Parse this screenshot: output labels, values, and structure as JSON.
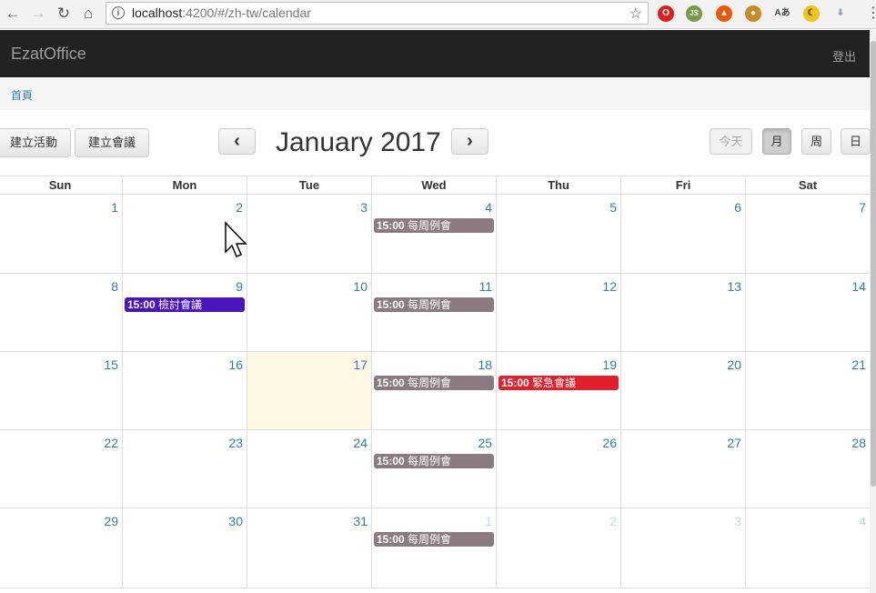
{
  "browser": {
    "url_host": "localhost",
    "url_rest": ":4200/#/zh-tw/calendar"
  },
  "navbar": {
    "brand": "EzatOffice",
    "logout": "登出"
  },
  "breadcrumb": {
    "home": "首頁"
  },
  "toolbar": {
    "create_activity": "建立活動",
    "create_meeting": "建立會議",
    "prev": "‹",
    "next": "›",
    "title": "January 2017",
    "today": "今天",
    "month": "月",
    "week": "周",
    "day": "日"
  },
  "weekdays": [
    "Sun",
    "Mon",
    "Tue",
    "Wed",
    "Thu",
    "Fri",
    "Sat"
  ],
  "weeks": [
    [
      {
        "d": "1"
      },
      {
        "d": "2"
      },
      {
        "d": "3"
      },
      {
        "d": "4",
        "e": {
          "time": "15:00",
          "title": "每周例會",
          "color": "#8b7b80"
        }
      },
      {
        "d": "5"
      },
      {
        "d": "6"
      },
      {
        "d": "7"
      }
    ],
    [
      {
        "d": "8"
      },
      {
        "d": "9",
        "e": {
          "time": "15:00",
          "title": "檢討會議",
          "color": "#4a14bf"
        }
      },
      {
        "d": "10"
      },
      {
        "d": "11",
        "e": {
          "time": "15:00",
          "title": "每周例會",
          "color": "#8b7b80"
        }
      },
      {
        "d": "12"
      },
      {
        "d": "13"
      },
      {
        "d": "14"
      }
    ],
    [
      {
        "d": "15"
      },
      {
        "d": "16"
      },
      {
        "d": "17",
        "today": true
      },
      {
        "d": "18",
        "e": {
          "time": "15:00",
          "title": "每周例會",
          "color": "#8b7b80"
        }
      },
      {
        "d": "19",
        "e": {
          "time": "15:00",
          "title": "緊急會議",
          "color": "#e0202a"
        }
      },
      {
        "d": "20"
      },
      {
        "d": "21"
      }
    ],
    [
      {
        "d": "22"
      },
      {
        "d": "23"
      },
      {
        "d": "24"
      },
      {
        "d": "25",
        "e": {
          "time": "15:00",
          "title": "每周例會",
          "color": "#8b7b80"
        }
      },
      {
        "d": "26"
      },
      {
        "d": "27"
      },
      {
        "d": "28"
      }
    ],
    [
      {
        "d": "29"
      },
      {
        "d": "30"
      },
      {
        "d": "31"
      },
      {
        "d": "1",
        "other": true,
        "e": {
          "time": "15:00",
          "title": "每周例會",
          "color": "#8b7b80"
        }
      },
      {
        "d": "2",
        "other": true
      },
      {
        "d": "3",
        "other": true
      },
      {
        "d": "4",
        "other": true
      }
    ]
  ]
}
